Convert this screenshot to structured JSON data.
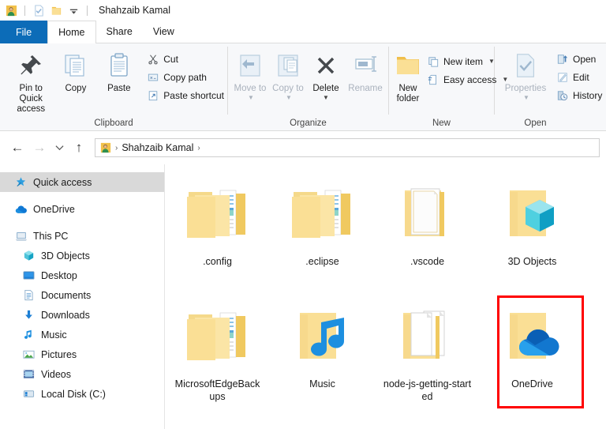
{
  "window": {
    "title": "Shahzaib Kamal",
    "quick_access_toolbar": [
      {
        "name": "user-account-icon",
        "label": "Properties"
      },
      {
        "name": "properties-icon",
        "label": "Properties"
      },
      {
        "name": "new-folder-icon",
        "label": "New folder"
      },
      {
        "name": "customize-qat-chevron-icon",
        "label": "Customize Quick Access Toolbar"
      }
    ]
  },
  "tabs": [
    {
      "label": "File",
      "state": "file"
    },
    {
      "label": "Home",
      "state": "active"
    },
    {
      "label": "Share",
      "state": "inactive"
    },
    {
      "label": "View",
      "state": "inactive"
    }
  ],
  "ribbon": {
    "groups": [
      {
        "title": "Clipboard",
        "big": [
          {
            "label": "Pin to Quick access",
            "icon": "pin-icon",
            "dim": false
          },
          {
            "label": "Copy",
            "icon": "copy-icon",
            "dim": false
          },
          {
            "label": "Paste",
            "icon": "paste-icon",
            "dim": false
          }
        ],
        "small": [
          {
            "label": "Cut",
            "icon": "scissors-icon"
          },
          {
            "label": "Copy path",
            "icon": "copy-path-icon"
          },
          {
            "label": "Paste shortcut",
            "icon": "paste-shortcut-icon"
          }
        ]
      },
      {
        "title": "Organize",
        "big": [
          {
            "label": "Move to",
            "icon": "move-to-icon",
            "dim": true,
            "caret": true
          },
          {
            "label": "Copy to",
            "icon": "copy-to-icon",
            "dim": true,
            "caret": true
          },
          {
            "label": "Delete",
            "icon": "delete-x-icon",
            "dim": false,
            "split": true
          },
          {
            "label": "Rename",
            "icon": "rename-icon",
            "dim": true
          }
        ],
        "small": []
      },
      {
        "title": "New",
        "big": [
          {
            "label": "New folder",
            "icon": "new-folder-icon",
            "dim": false
          }
        ],
        "small": [
          {
            "label": "New item",
            "icon": "new-item-icon",
            "caret": true
          },
          {
            "label": "Easy access",
            "icon": "easy-access-icon",
            "caret": true
          }
        ]
      },
      {
        "title": "Open",
        "big": [
          {
            "label": "Properties",
            "icon": "properties-icon",
            "dim": true,
            "split": true
          }
        ],
        "small": [
          {
            "label": "Open",
            "icon": "open-icon"
          },
          {
            "label": "Edit",
            "icon": "edit-icon"
          },
          {
            "label": "History",
            "icon": "history-icon"
          }
        ]
      }
    ]
  },
  "address_bar": {
    "back": "←",
    "forward": "→",
    "recent": "ⱟ",
    "up": "↑",
    "breadcrumb_icon": "user-account-icon",
    "breadcrumb_text": "Shahzaib Kamal",
    "breadcrumb_separator": "›"
  },
  "sidebar": {
    "items": [
      {
        "label": "Quick access",
        "icon": "star-pin-icon",
        "level": 0,
        "selected": true,
        "gap_before": false
      },
      {
        "label": "OneDrive",
        "icon": "onedrive-cloud-icon",
        "level": 0,
        "selected": false,
        "gap_before": true
      },
      {
        "label": "This PC",
        "icon": "this-pc-icon",
        "level": 0,
        "selected": false,
        "gap_before": true
      },
      {
        "label": "3D Objects",
        "icon": "3d-objects-icon",
        "level": 1,
        "selected": false,
        "gap_before": false
      },
      {
        "label": "Desktop",
        "icon": "desktop-icon",
        "level": 1,
        "selected": false,
        "gap_before": false
      },
      {
        "label": "Documents",
        "icon": "documents-icon",
        "level": 1,
        "selected": false,
        "gap_before": false
      },
      {
        "label": "Downloads",
        "icon": "downloads-icon",
        "level": 1,
        "selected": false,
        "gap_before": false
      },
      {
        "label": "Music",
        "icon": "music-note-icon",
        "level": 1,
        "selected": false,
        "gap_before": false
      },
      {
        "label": "Pictures",
        "icon": "pictures-icon",
        "level": 1,
        "selected": false,
        "gap_before": false
      },
      {
        "label": "Videos",
        "icon": "videos-icon",
        "level": 1,
        "selected": false,
        "gap_before": false
      },
      {
        "label": "Local Disk (C:)",
        "icon": "local-disk-icon",
        "level": 1,
        "selected": false,
        "gap_before": false
      }
    ]
  },
  "files": {
    "items": [
      {
        "name": ".config",
        "icon": "folder-with-files-icon",
        "highlighted": false
      },
      {
        "name": ".eclipse",
        "icon": "folder-with-files-icon",
        "highlighted": false
      },
      {
        "name": ".vscode",
        "icon": "folder-with-document-icon",
        "highlighted": false
      },
      {
        "name": "3D Objects",
        "icon": "folder-3d-objects-icon",
        "highlighted": false
      },
      {
        "name": "MicrosoftEdgeBackups",
        "icon": "folder-with-files-icon",
        "highlighted": false
      },
      {
        "name": "Music",
        "icon": "folder-music-icon",
        "highlighted": false
      },
      {
        "name": "node-js-getting-started",
        "icon": "folder-with-documents-icon",
        "highlighted": false
      },
      {
        "name": "OneDrive",
        "icon": "folder-onedrive-icon",
        "highlighted": true
      }
    ]
  },
  "colors": {
    "file_tab_blue": "#0c6cb8",
    "ribbon_bg": "#f7f8fa",
    "selection_gray": "#d9d9d9",
    "folder_yellow": "#fadf95",
    "highlight_red": "#ff0000",
    "onedrive_blue": "#0f78d4"
  }
}
